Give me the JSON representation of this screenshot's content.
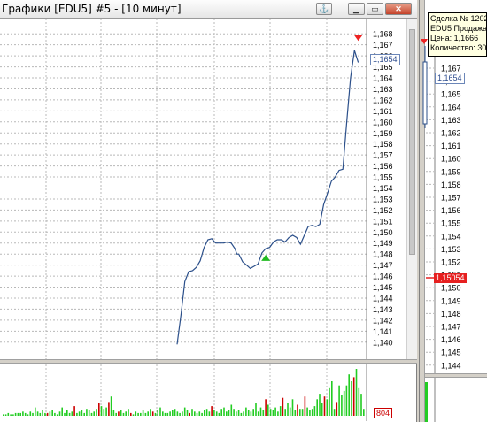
{
  "window": {
    "title": "Графики [EDU5] #5 - [10 минут]",
    "pin_icon": "anchor-icon",
    "minimize_icon": "minimize-icon",
    "maximize_icon": "maximize-icon",
    "close_icon": "close-icon"
  },
  "colors": {
    "price_line": "#2b4f8a",
    "grid": "#b8b8b8",
    "volume_up": "#22cc22",
    "volume_down": "#cc0000",
    "sell_marker": "#ee2222",
    "buy_marker": "#22bb22",
    "current_price_bg": "#e62020"
  },
  "main_chart": {
    "last_price_label": "1,1654",
    "volume_label": "804",
    "price_ticks": [
      "1,168",
      "1,167",
      "1,166",
      "1,165",
      "1,164",
      "1,163",
      "1,162",
      "1,161",
      "1,160",
      "1,159",
      "1,158",
      "1,157",
      "1,156",
      "1,155",
      "1,154",
      "1,153",
      "1,152",
      "1,151",
      "1,150",
      "1,149",
      "1,148",
      "1,147",
      "1,146",
      "1,145",
      "1,144",
      "1,143",
      "1,142",
      "1,141",
      "1,140"
    ]
  },
  "tooltip": {
    "line1": "Сделка № 1202",
    "line2": "EDU5 Продажа",
    "line3": "Цена: 1,1666",
    "line4": "Количество: 30"
  },
  "side_chart": {
    "last_price_label": "1,1654",
    "current_price_label": "1,15054",
    "bottom_label": "",
    "price_ticks": [
      "1,167",
      "1,166",
      "1,165",
      "1,164",
      "1,163",
      "1,162",
      "1,161",
      "1,160",
      "1,159",
      "1,158",
      "1,157",
      "1,156",
      "1,155",
      "1,154",
      "1,153",
      "1,152",
      "1,151",
      "1,150",
      "1,149",
      "1,148",
      "1,147",
      "1,146",
      "1,145",
      "1,144"
    ]
  },
  "chart_data": [
    {
      "type": "line",
      "title": "",
      "xlabel": "",
      "ylabel": "",
      "ylim": [
        1.1395,
        1.1685
      ],
      "x": [
        0,
        1,
        2,
        3,
        4,
        5,
        6,
        7,
        8,
        9,
        10,
        11,
        12,
        13,
        14,
        15,
        15.5,
        16,
        17,
        18,
        19,
        20,
        21,
        22,
        23,
        24,
        25,
        26,
        27,
        28,
        29,
        30,
        31,
        32,
        33,
        34,
        35,
        36,
        37,
        38,
        39,
        40,
        41,
        42,
        43,
        44,
        45,
        46,
        47,
        48
      ],
      "series": [
        {
          "values": [
            1.1398,
            1.1425,
            1.1455,
            1.1464,
            1.1465,
            1.1468,
            1.1474,
            1.1486,
            1.1493,
            1.1494,
            1.149,
            1.149,
            1.149,
            1.1491,
            1.149,
            1.1485,
            1.148,
            1.148,
            1.1473,
            1.147,
            1.1467,
            1.1469,
            1.1471,
            1.1481,
            1.1485,
            1.1486,
            1.1491,
            1.1493,
            1.1493,
            1.1491,
            1.1495,
            1.1497,
            1.1495,
            1.1489,
            1.1497,
            1.1505,
            1.1506,
            1.1505,
            1.1507,
            1.1525,
            1.1535,
            1.1546,
            1.155,
            1.1556,
            1.1557,
            1.16,
            1.164,
            1.1665,
            1.1654
          ]
        }
      ],
      "markers": [
        {
          "kind": "sell",
          "x": 47,
          "y": 1.1676
        },
        {
          "kind": "buy",
          "x": 23,
          "y": 1.1477
        }
      ]
    },
    {
      "type": "bar",
      "title": "",
      "values": [
        1,
        1,
        2,
        1,
        1,
        2,
        2,
        2,
        3,
        2,
        1,
        3,
        2,
        6,
        3,
        2,
        4,
        2,
        2,
        3,
        4,
        2,
        1,
        3,
        6,
        2,
        4,
        2,
        3,
        7,
        2,
        3,
        4,
        2,
        5,
        4,
        2,
        3,
        5,
        9,
        7,
        5,
        6,
        10,
        14,
        4,
        2,
        3,
        4,
        2,
        3,
        5,
        2,
        1,
        3,
        2,
        2,
        4,
        2,
        3,
        5,
        3,
        2,
        4,
        6,
        3,
        2,
        2,
        3,
        4,
        5,
        3,
        2,
        3,
        6,
        4,
        2,
        5,
        3,
        2,
        3,
        2,
        4,
        5,
        3,
        7,
        4,
        3,
        2,
        5,
        6,
        3,
        4,
        8,
        5,
        3,
        4,
        2,
        3,
        6,
        4,
        3,
        5,
        9,
        3,
        6,
        4,
        12,
        8,
        5,
        4,
        6,
        3,
        7,
        13,
        5,
        9,
        6,
        12,
        4,
        8,
        5,
        5,
        14,
        6,
        4,
        5,
        7,
        12,
        16,
        9,
        14,
        12,
        20,
        25,
        5,
        10,
        22,
        15,
        18,
        22,
        30,
        25,
        28,
        34,
        20,
        16,
        5
      ],
      "down_indices": [
        18,
        29,
        39,
        43,
        47,
        52,
        61,
        76,
        85,
        107,
        114,
        120,
        123,
        131,
        136,
        143
      ]
    }
  ]
}
